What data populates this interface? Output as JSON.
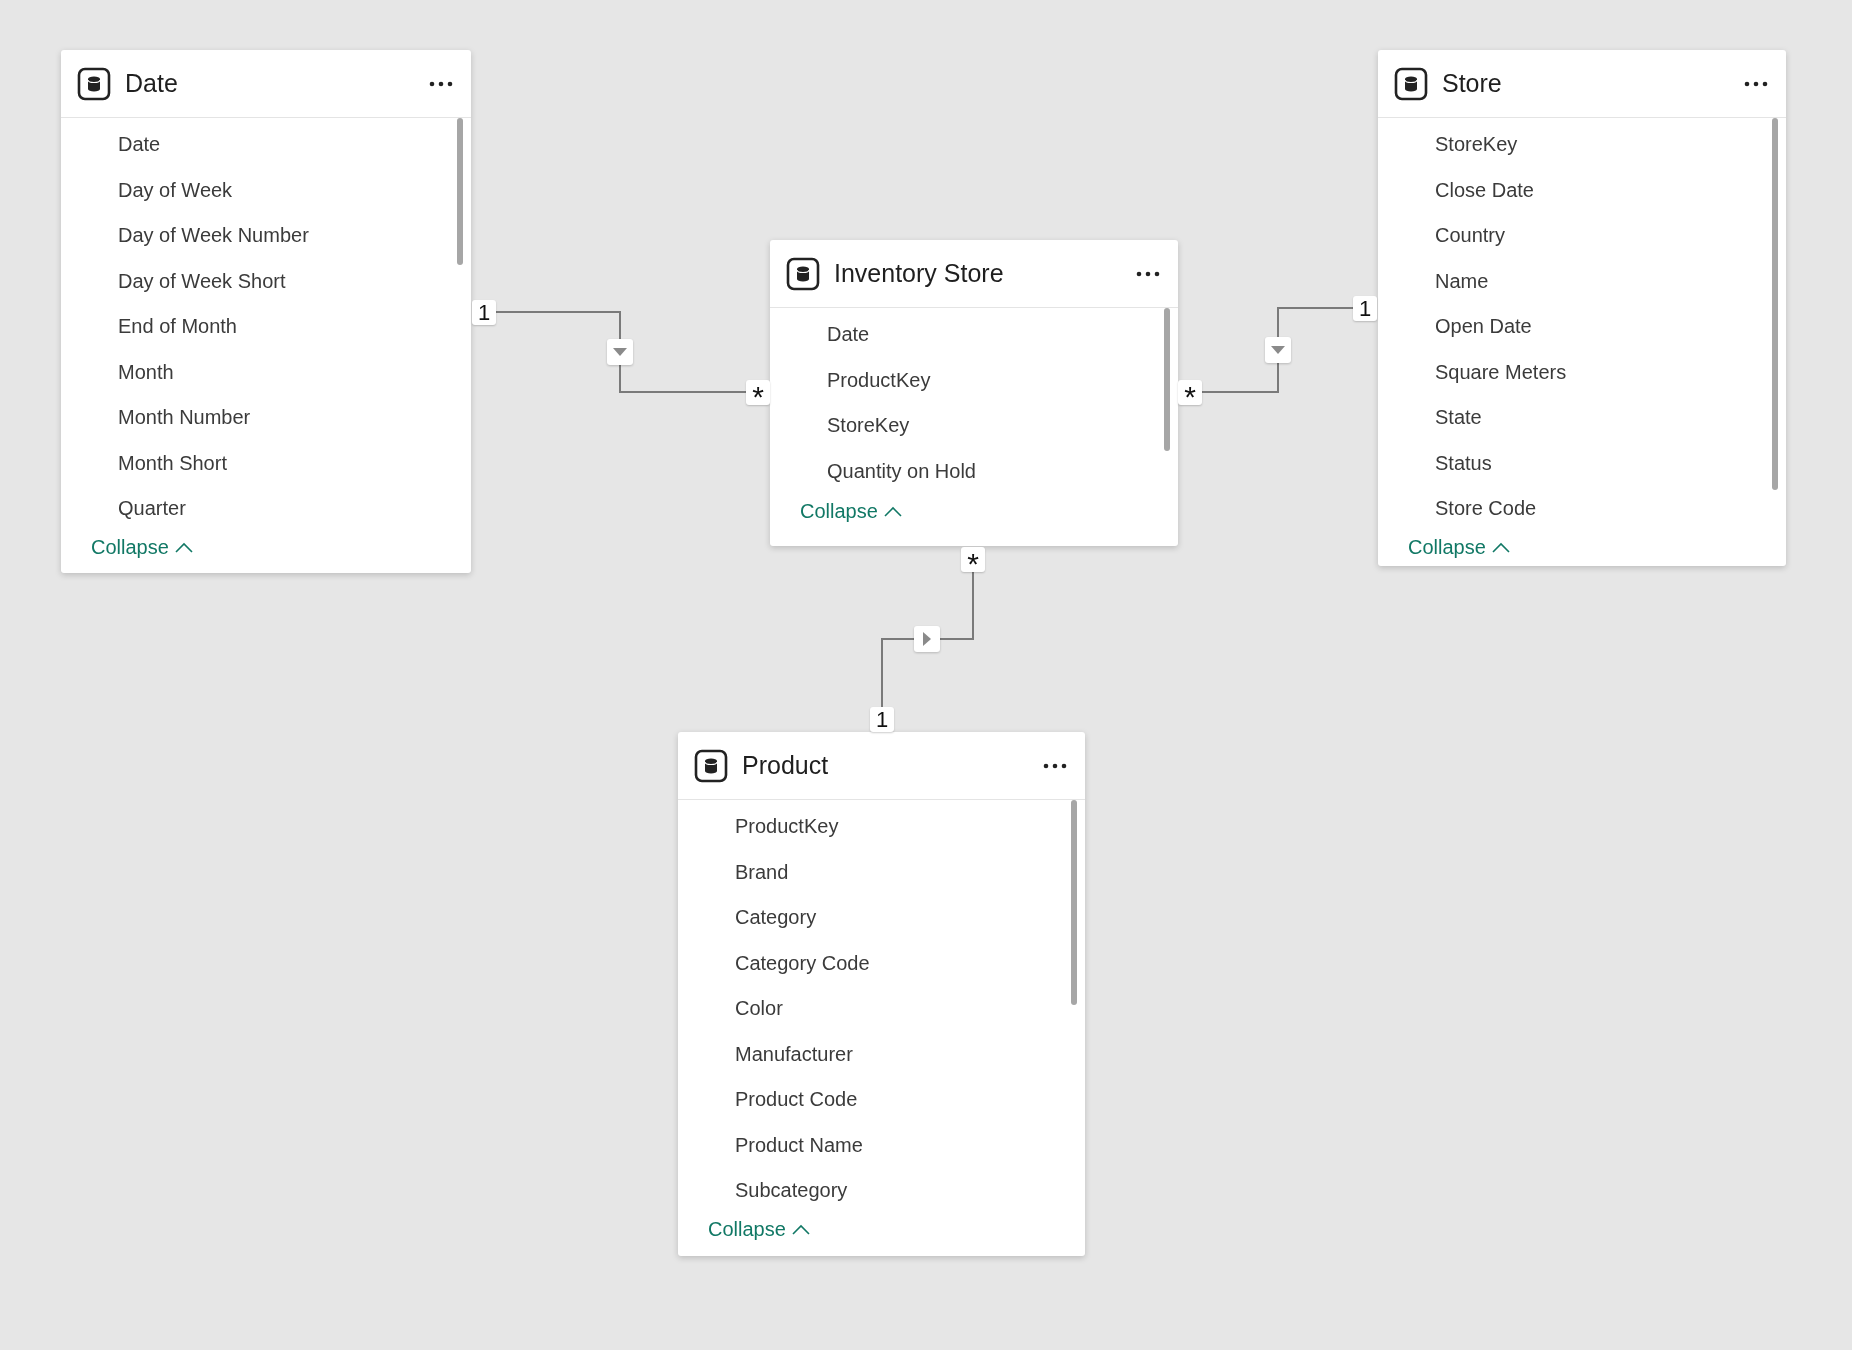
{
  "tables": [
    {
      "title": "Date",
      "fields": [
        "Date",
        "Day of Week",
        "Day of Week Number",
        "Day of Week Short",
        "End of Month",
        "Month",
        "Month Number",
        "Month Short",
        "Quarter"
      ],
      "collapse_label": "Collapse"
    },
    {
      "title": "Inventory Store",
      "fields": [
        "Date",
        "ProductKey",
        "StoreKey",
        "Quantity on Hold"
      ],
      "collapse_label": "Collapse"
    },
    {
      "title": "Store",
      "fields": [
        "StoreKey",
        "Close Date",
        "Country",
        "Name",
        "Open Date",
        "Square Meters",
        "State",
        "Status",
        "Store Code"
      ],
      "collapse_label": "Collapse"
    },
    {
      "title": "Product",
      "fields": [
        "ProductKey",
        "Brand",
        "Category",
        "Category Code",
        "Color",
        "Manufacturer",
        "Product Code",
        "Product Name",
        "Subcategory"
      ],
      "collapse_label": "Collapse"
    }
  ],
  "relationships": [
    {
      "one_end": "1",
      "many_end": "*",
      "kind": "down"
    },
    {
      "one_end": "1",
      "many_end": "*",
      "kind": "down"
    },
    {
      "one_end": "1",
      "many_end": "*",
      "kind": "right"
    }
  ]
}
